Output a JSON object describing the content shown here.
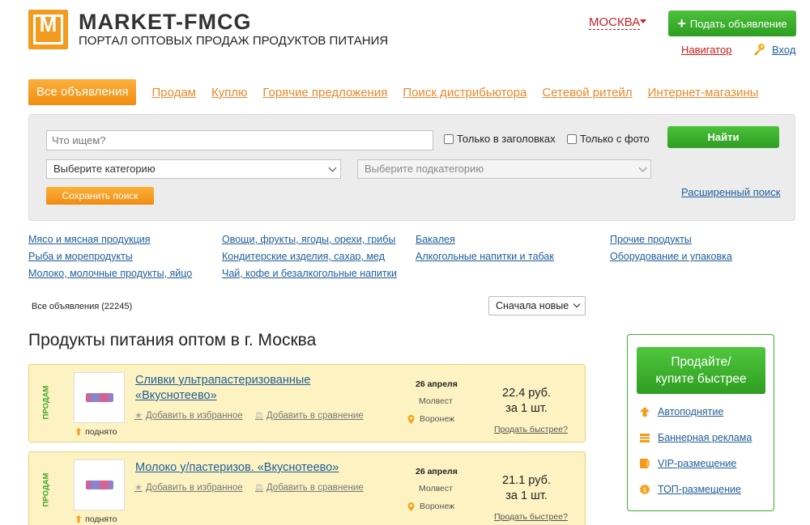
{
  "header": {
    "logo_letter": "M",
    "site_name": "MARKET-FMCG",
    "tagline": "ПОРТАЛ ОПТОВЫХ ПРОДАЖ ПРОДУКТОВ ПИТАНИЯ",
    "city": "МОСКВА",
    "post_button": "Подать объявление",
    "navigator": "Навигатор",
    "login": "Вход"
  },
  "nav": {
    "active": "Все объявления",
    "items": [
      "Продам",
      "Куплю",
      "Горячие предложения",
      "Поиск дистрибьютора",
      "Сетевой ритейл",
      "Интернет-магазины"
    ]
  },
  "search": {
    "placeholder": "Что ищем?",
    "only_titles": "Только в заголовках",
    "only_photo": "Только с фото",
    "find_button": "Найти",
    "category_select": "Выберите категорию",
    "subcategory_select": "Выберите подкатегорию",
    "save_button": "Сохранить поиск",
    "advanced": "Расширенный поиск"
  },
  "categories": {
    "col1": [
      "Мясо и мясная продукция",
      "Рыба и морепродукты",
      "Молоко, молочные продукты, яйцо"
    ],
    "col2": [
      "Овощи, фрукты, ягоды, орехи, грибы",
      "Кондитерские изделия, сахар, мед",
      "Чай, кофе и безалкогольные напитки"
    ],
    "col3": [
      "Бакалея",
      "Алкогольные напитки и табак"
    ],
    "col4": [
      "Прочие продукты",
      "Оборудование и упаковка"
    ]
  },
  "list": {
    "count_label": "Все объявления (22245)",
    "sort": "Сначала новые",
    "title": "Продукты питания оптом в г. Москва"
  },
  "listings": [
    {
      "tag": "ПРОДАМ",
      "title": "Сливки ультрапастеризованные «Вкуснотеево»",
      "raised": "поднято",
      "favorite": "Добавить в избранное",
      "compare": "Добавить в сравнение",
      "date": "26 апреля",
      "company": "Молвест",
      "city": "Воронеж",
      "price_line1": "22.4 руб.",
      "price_line2": "за 1 шт.",
      "sell_faster": "Продать быстрее?"
    },
    {
      "tag": "ПРОДАМ",
      "title": "Молоко у/пастеризов. «Вкуснотеево»",
      "raised": "поднято",
      "favorite": "Добавить в избранное",
      "compare": "Добавить в сравнение",
      "date": "26 апреля",
      "company": "Молвест",
      "city": "Воронеж",
      "price_line1": "21.1 руб.",
      "price_line2": "за 1 шт.",
      "sell_faster": "Продать быстрее?"
    }
  ],
  "sidebar": {
    "promo_line1": "Продайте/",
    "promo_line2": "купите быстрее",
    "services": [
      "Автоподнятие",
      "Баннерная реклама",
      "VIP-размещение",
      "ТОП-размещение"
    ],
    "service_icons": [
      "arrow-up-icon",
      "banner-icon",
      "vip-icon",
      "top-icon"
    ]
  },
  "colors": {
    "orange": "#f39b1f",
    "green": "#3aaf29",
    "link_blue": "#1f5d9a",
    "red": "#d01f1f",
    "listing_bg": "#fdf3c2"
  }
}
